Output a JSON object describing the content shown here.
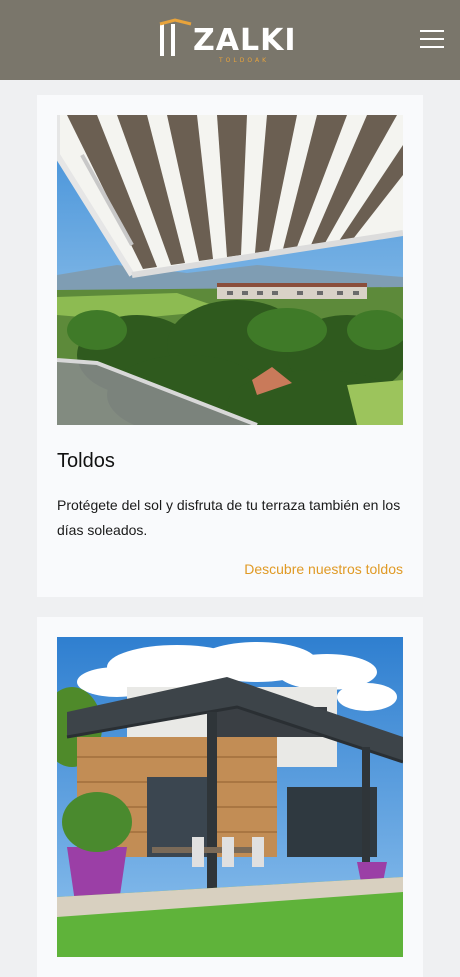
{
  "header": {
    "logo_text": "ZALKI",
    "logo_subtext": "TOLDOAK",
    "menu_icon": "hamburger-menu-icon",
    "background_color": "#7a766b",
    "accent_color": "#e8a33b"
  },
  "cards": [
    {
      "title": "Toldos",
      "description": "Protégete del sol y disfruta de tu terraza también en los días soleados.",
      "link_label": "Descubre nuestros toldos",
      "image": "striped-awning-over-green-valley-photo"
    },
    {
      "image": "modern-house-with-pergola-photo"
    }
  ],
  "colors": {
    "link": "#e09a25",
    "page_background": "#eff0f2",
    "card_background": "#f9fafc"
  }
}
